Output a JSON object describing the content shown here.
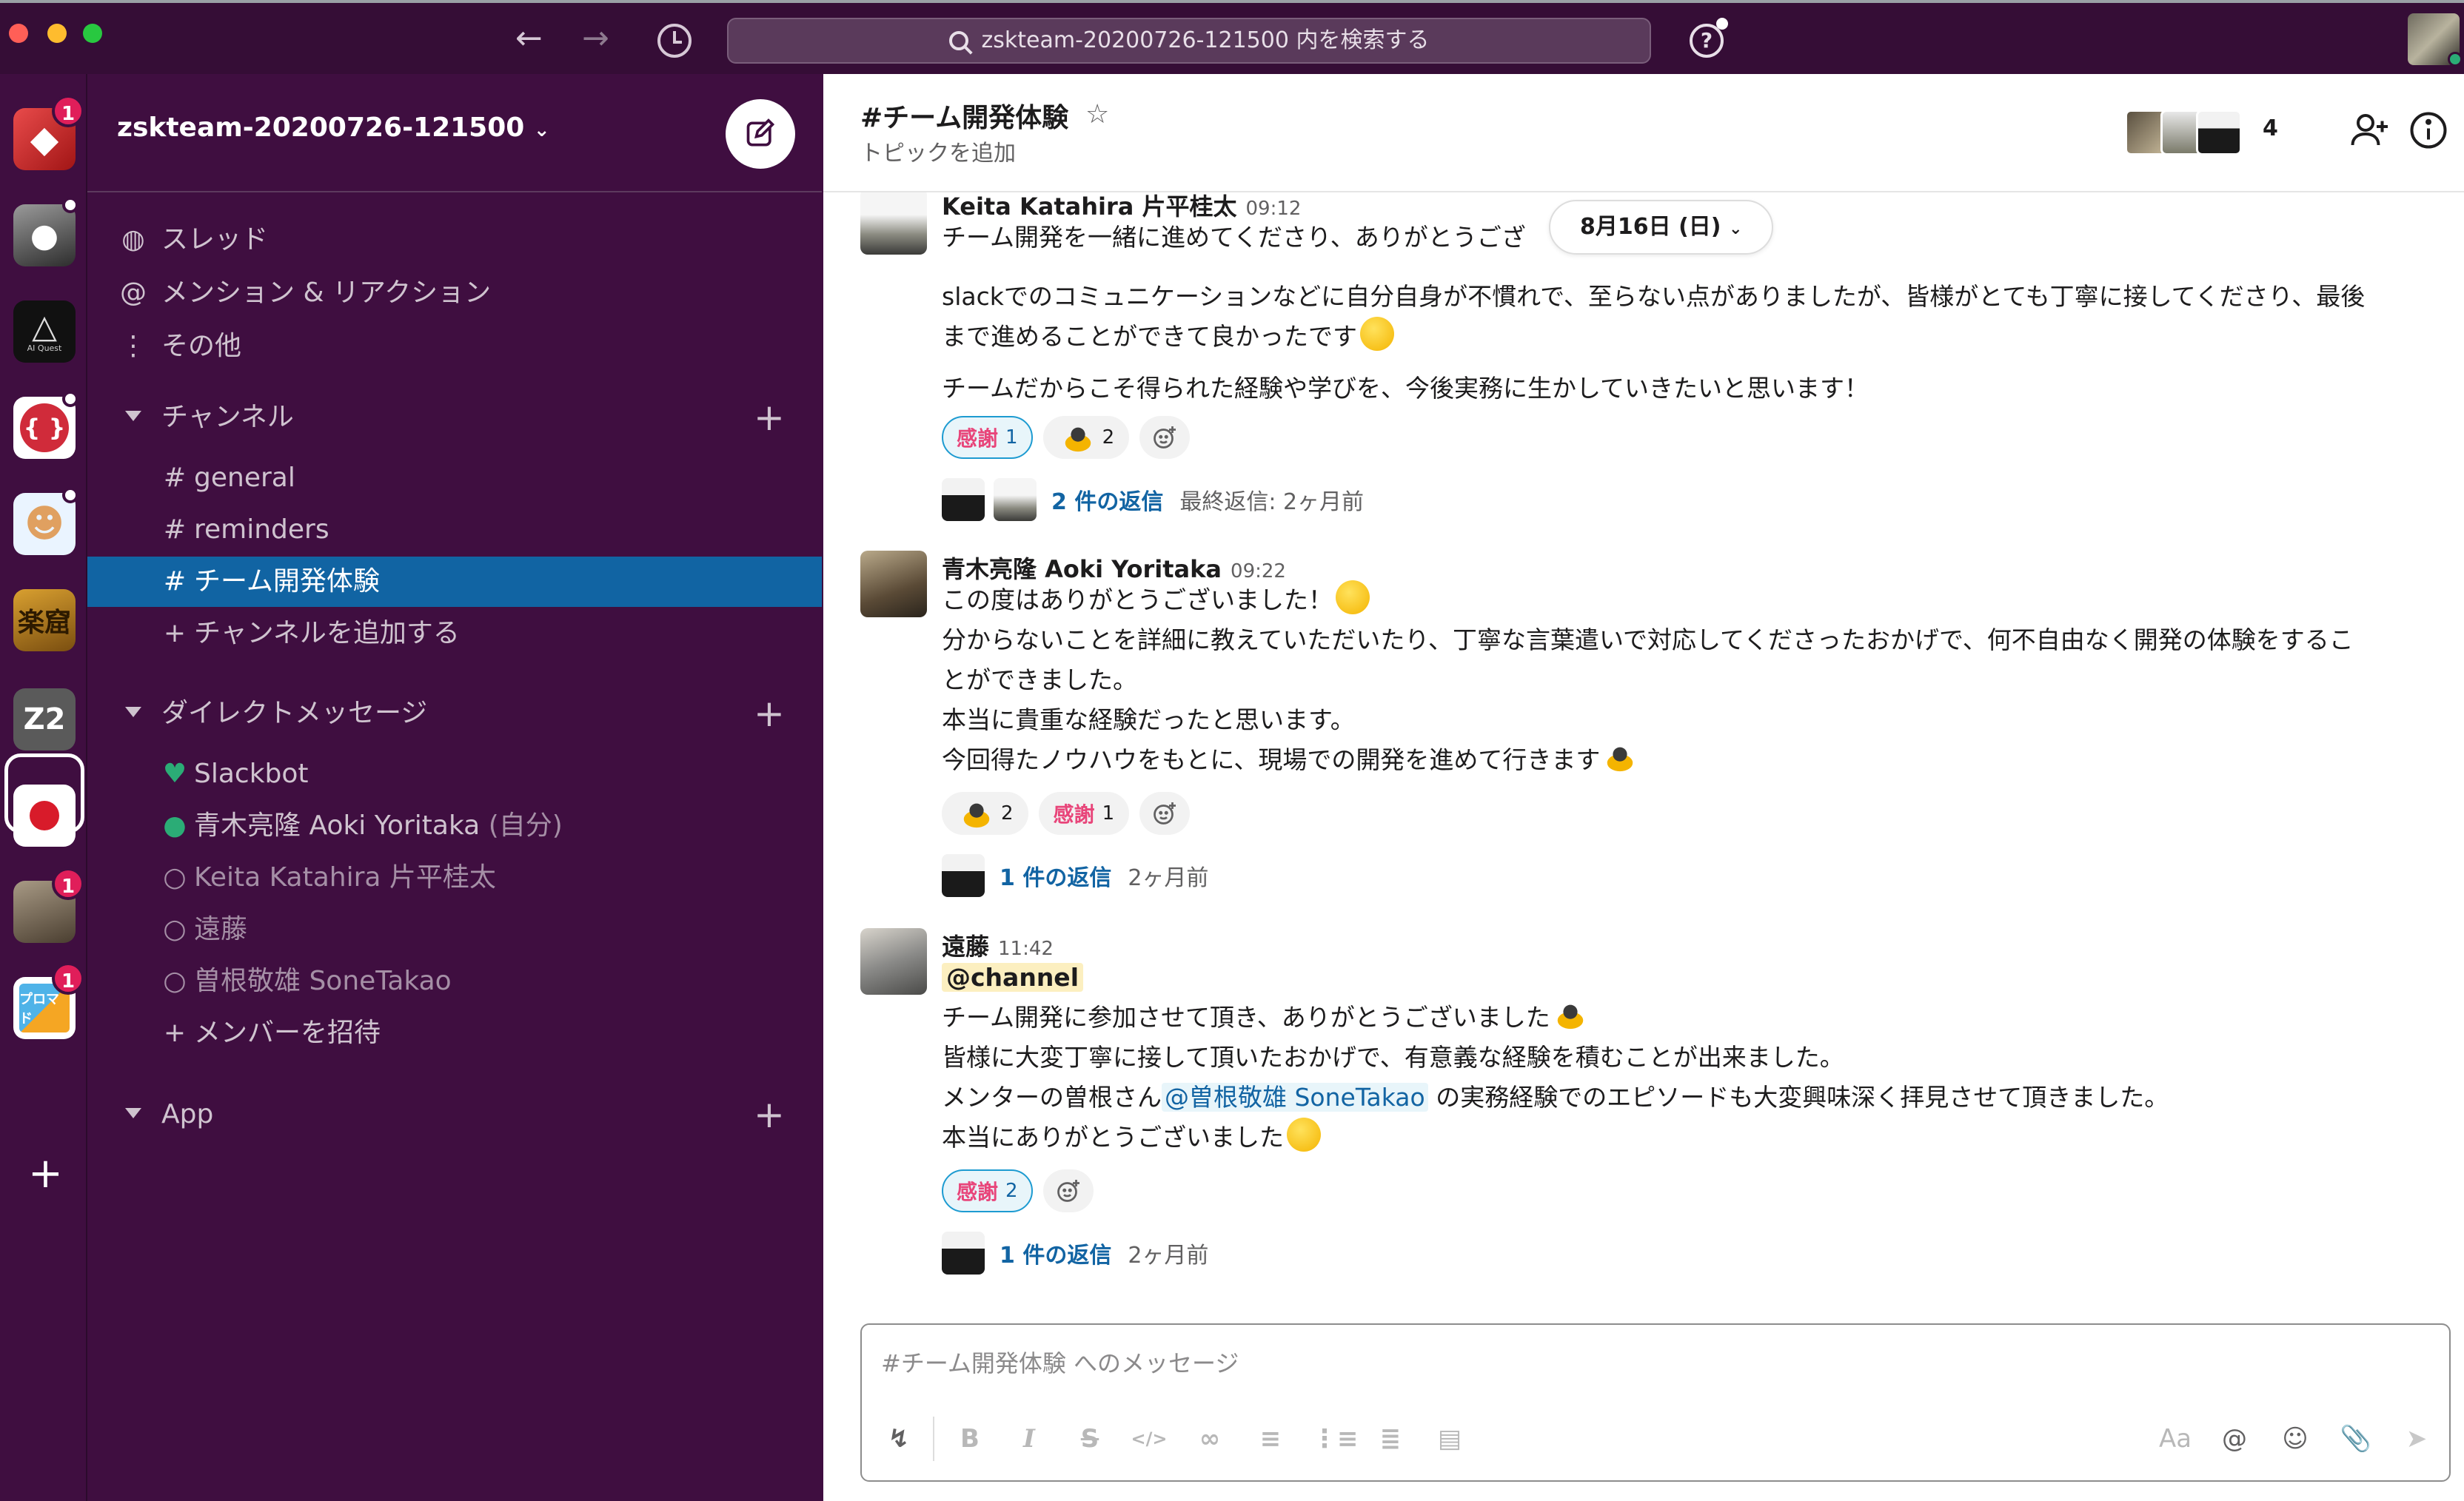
{
  "titlebar": {
    "search_text": "zskteam-20200726-121500 内を検索する",
    "traffic_colors": [
      "#ff5f57",
      "#febc2e",
      "#28c840"
    ]
  },
  "rail": {
    "workspaces": [
      {
        "name": "ruby-workspace",
        "badge": "1",
        "color": "#cc2a2a"
      },
      {
        "name": "gorilla-workspace",
        "dot": true,
        "color": "#555555"
      },
      {
        "name": "ai-quest-workspace",
        "text": "AI Quest",
        "dot": false,
        "color": "#111111"
      },
      {
        "name": "code-workspace",
        "dot": true,
        "color": "#d02b3a"
      },
      {
        "name": "person-workspace",
        "dot": true,
        "color": "#3a8ad6"
      },
      {
        "name": "gakukutsu-workspace",
        "text": "楽窟",
        "color": "#9a6a1a"
      },
      {
        "name": "z2-workspace",
        "text": "Z2",
        "color": "#4a4a4a"
      },
      {
        "name": "japan-workspace",
        "color": "#ffffff"
      },
      {
        "name": "photo-workspace",
        "badge": "1",
        "color": "#7a6a55"
      },
      {
        "name": "blocks-workspace",
        "badge": "1",
        "text": "プロマド",
        "color": "#4fb3e8"
      }
    ]
  },
  "sidebar": {
    "workspace_name": "zskteam-20200726-121500",
    "nav": [
      {
        "icon": "threads-icon",
        "label": "スレッド"
      },
      {
        "icon": "at-icon",
        "label": "メンション & リアクション"
      },
      {
        "icon": "more-vertical-icon",
        "label": "その他"
      }
    ],
    "channels_header": "チャンネル",
    "channels": [
      {
        "label": "general"
      },
      {
        "label": "reminders"
      },
      {
        "label": "チーム開発体験",
        "active": true
      }
    ],
    "add_channel": "チャンネルを追加する",
    "dm_header": "ダイレクトメッセージ",
    "dms": [
      {
        "label": "Slackbot"
      },
      {
        "label": "青木亮隆 Aoki Yoritaka",
        "suffix": "(自分)"
      },
      {
        "label": "Keita Katahira 片平桂太"
      },
      {
        "label": "遠藤"
      },
      {
        "label": "曽根敬雄 SoneTakao"
      }
    ],
    "invite": "メンバーを招待",
    "app_header": "App"
  },
  "channel": {
    "title": "#チーム開発体験",
    "topic": "トピックを追加",
    "member_count": "4",
    "date_pill": "8月16日 (日)"
  },
  "messages": {
    "m1": {
      "author": "Keita Katahira 片平桂太",
      "time": "09:12",
      "lines": [
        "チーム開発を一緒に進めてくださり、ありがとうござ",
        "slackでのコミュニケーションなどに自分自身が不慣れで、至らない点がありましたが、皆様がとても丁寧に接してくださり、最後",
        "まで進めることができて良かったです",
        "チームだからこそ得られた経験や学びを、今後実務に生かしていきたいと思います！"
      ],
      "reactions": [
        {
          "label": "感謝",
          "count": "1"
        },
        {
          "label": "bow",
          "count": "2"
        }
      ],
      "thread_link": "2 件の返信",
      "thread_meta": "最終返信: 2ヶ月前"
    },
    "m2": {
      "author": "青木亮隆 Aoki Yoritaka",
      "time": "09:22",
      "lines": [
        "この度はありがとうございました！",
        "分からないことを詳細に教えていただいたり、丁寧な言葉遣いで対応してくださったおかげで、何不自由なく開発の体験をするこ",
        "とができました。",
        "本当に貴重な経験だったと思います。",
        "今回得たノウハウをもとに、現場での開発を進めて行きます"
      ],
      "reactions": [
        {
          "label": "bow",
          "count": "2"
        },
        {
          "label": "感謝",
          "count": "1"
        }
      ],
      "thread_link": "1 件の返信",
      "thread_meta": "2ヶ月前"
    },
    "m3": {
      "author": "遠藤",
      "time": "11:42",
      "channel_mention": "@channel",
      "lines": [
        "チーム開発に参加させて頂き、ありがとうございました",
        "皆様に大変丁寧に接して頂いたおかげで、有意義な経験を積むことが出来ました。",
        "メンターの曽根さん",
        "の実務経験でのエピソードも大変興味深く拝見させて頂きました。",
        "本当にありがとうございました"
      ],
      "user_mention": "@曽根敬雄 SoneTakao",
      "reactions": [
        {
          "label": "感謝",
          "count": "2"
        }
      ],
      "thread_link": "1 件の返信",
      "thread_meta": "2ヶ月前"
    }
  },
  "composer": {
    "placeholder": "#チーム開発体験 へのメッセージ",
    "format_label": "Aa"
  }
}
